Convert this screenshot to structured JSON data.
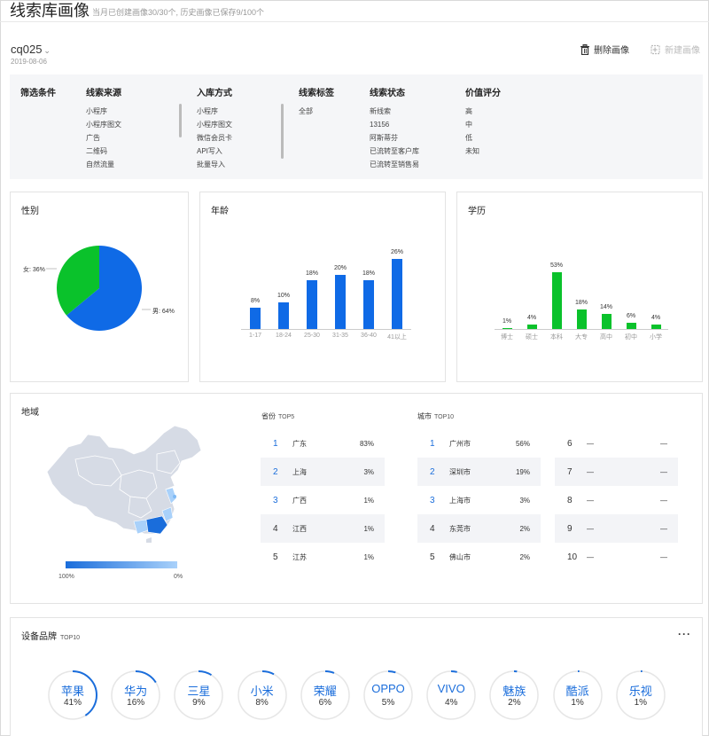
{
  "header": {
    "title": "线索库画像",
    "subtitle": "当月已创建画像30/30个, 历史画像已保存9/100个"
  },
  "profile": {
    "name": "cq025",
    "date": "2019-08-06"
  },
  "actions": {
    "delete_label": "删除画像",
    "new_label": "新建画像"
  },
  "filters": {
    "label": "筛选条件",
    "columns": [
      {
        "title": "线索来源",
        "items": [
          "小程序",
          "小程序图文",
          "广告",
          "二维码",
          "自然流量"
        ]
      },
      {
        "title": "入库方式",
        "items": [
          "小程序",
          "小程序图文",
          "微信会员卡",
          "API写入",
          "批量导入"
        ]
      },
      {
        "title": "线索标签",
        "items": [
          "全部"
        ]
      },
      {
        "title": "线索状态",
        "items": [
          "新线索",
          "13156",
          "阿斯蒂芬",
          "已流转至客户库",
          "已流转至销售易"
        ]
      },
      {
        "title": "价值评分",
        "items": [
          "高",
          "中",
          "低",
          "未知"
        ]
      }
    ]
  },
  "gender": {
    "title": "性别",
    "female_label": "女: 36%",
    "male_label": "男: 64%",
    "female": 36,
    "male": 64,
    "colors": {
      "female": "#0ac22b",
      "male": "#0f6ae6"
    }
  },
  "age": {
    "title": "年龄",
    "color": "#0f6ae6",
    "categories": [
      "1-17",
      "18-24",
      "25-30",
      "31-35",
      "36-40",
      "41以上"
    ],
    "labels": [
      "8%",
      "10%",
      "18%",
      "20%",
      "18%",
      "26%"
    ],
    "values": [
      8,
      10,
      18,
      20,
      18,
      26
    ]
  },
  "education": {
    "title": "学历",
    "color": "#0ac22b",
    "categories": [
      "博士",
      "硕士",
      "本科",
      "大专",
      "高中",
      "初中",
      "小学"
    ],
    "labels": [
      "1%",
      "4%",
      "53%",
      "18%",
      "14%",
      "6%",
      "4%"
    ],
    "values": [
      1,
      4,
      53,
      18,
      14,
      6,
      4
    ]
  },
  "region": {
    "title": "地域",
    "legend_max": "100%",
    "legend_min": "0%",
    "province": {
      "head": "省份",
      "head_en": "TOP5",
      "rows": [
        {
          "rank": "1",
          "name": "广东",
          "pct": "83%"
        },
        {
          "rank": "2",
          "name": "上海",
          "pct": "3%"
        },
        {
          "rank": "3",
          "name": "广西",
          "pct": "1%"
        },
        {
          "rank": "4",
          "name": "江西",
          "pct": "1%"
        },
        {
          "rank": "5",
          "name": "江苏",
          "pct": "1%"
        }
      ]
    },
    "city": {
      "head": "城市",
      "head_en": "TOP10",
      "rows": [
        {
          "rank": "1",
          "name": "广州市",
          "pct": "56%"
        },
        {
          "rank": "2",
          "name": "深圳市",
          "pct": "19%"
        },
        {
          "rank": "3",
          "name": "上海市",
          "pct": "3%"
        },
        {
          "rank": "4",
          "name": "东莞市",
          "pct": "2%"
        },
        {
          "rank": "5",
          "name": "佛山市",
          "pct": "2%"
        },
        {
          "rank": "6",
          "name": "—",
          "pct": "—"
        },
        {
          "rank": "7",
          "name": "—",
          "pct": "—"
        },
        {
          "rank": "8",
          "name": "—",
          "pct": "—"
        },
        {
          "rank": "9",
          "name": "—",
          "pct": "—"
        },
        {
          "rank": "10",
          "name": "—",
          "pct": "—"
        }
      ]
    }
  },
  "devices": {
    "title": "设备品牌",
    "title_en": "TOP10",
    "more": "···",
    "brands": [
      {
        "name": "苹果",
        "pct": "41%",
        "value": 41
      },
      {
        "name": "华为",
        "pct": "16%",
        "value": 16
      },
      {
        "name": "三星",
        "pct": "9%",
        "value": 9
      },
      {
        "name": "小米",
        "pct": "8%",
        "value": 8
      },
      {
        "name": "荣耀",
        "pct": "6%",
        "value": 6
      },
      {
        "name": "OPPO",
        "pct": "5%",
        "value": 5
      },
      {
        "name": "VIVO",
        "pct": "4%",
        "value": 4
      },
      {
        "name": "魅族",
        "pct": "2%",
        "value": 2
      },
      {
        "name": "酷派",
        "pct": "1%",
        "value": 1
      },
      {
        "name": "乐视",
        "pct": "1%",
        "value": 1
      }
    ]
  }
}
